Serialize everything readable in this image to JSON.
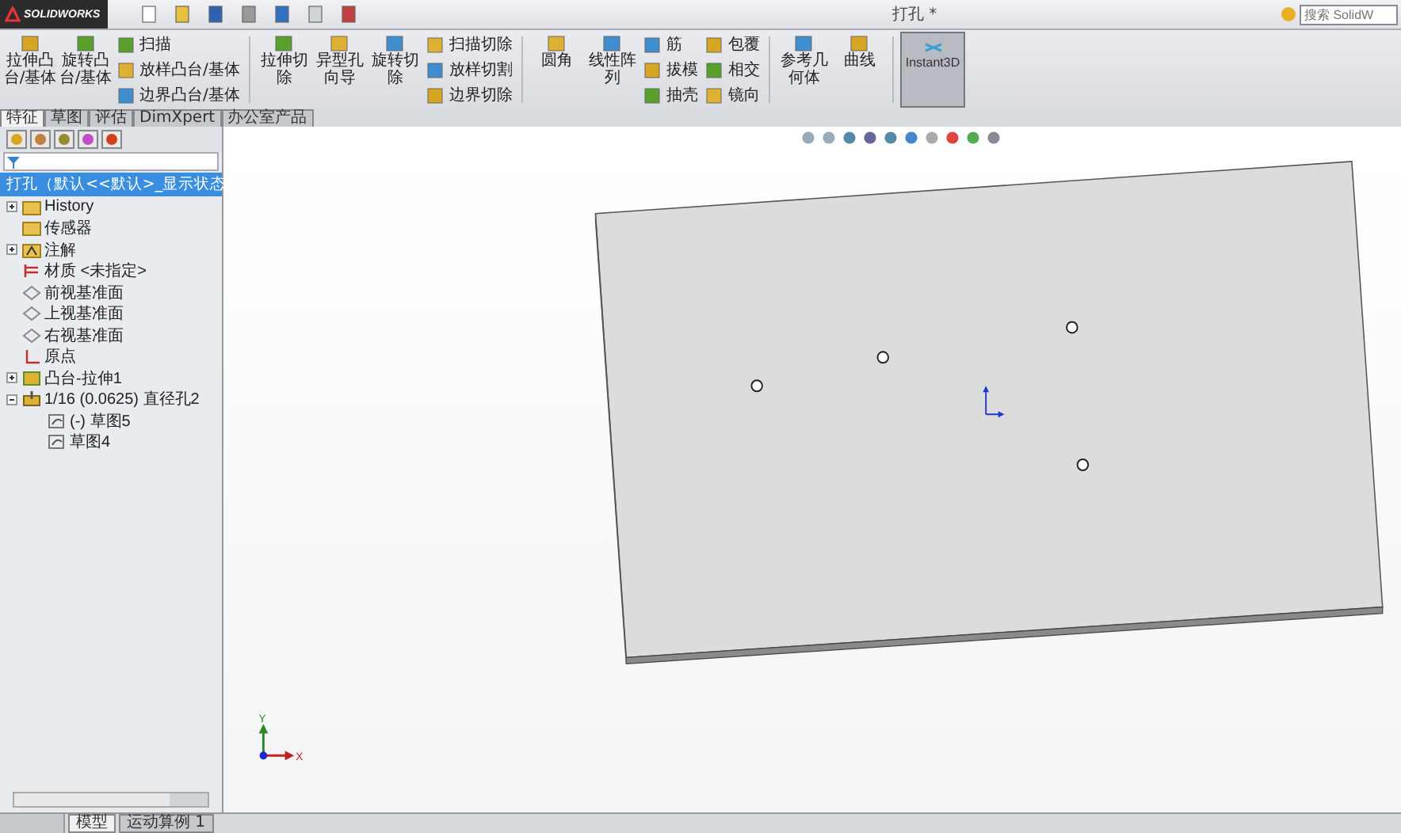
{
  "window": {
    "title": "打孔 *",
    "brand": "SOLIDWORKS",
    "search": {
      "placeholder": "搜索 SolidW"
    }
  },
  "ribbon": {
    "groups": [
      {
        "large": [
          "拉伸凸台/基体",
          "旋转凸台/基体"
        ],
        "small_columns": [
          [
            "扫描",
            "放样凸台/基体",
            "边界凸台/基体"
          ]
        ]
      },
      {
        "large": [
          "拉伸切除",
          "异型孔向导",
          "旋转切除"
        ],
        "small_columns": [
          [
            "扫描切除",
            "放样切割",
            "边界切除"
          ]
        ]
      },
      {
        "large": [
          "圆角",
          "线性阵列"
        ],
        "small_columns": [
          [
            "筋",
            "拔模",
            "抽壳"
          ],
          [
            "包覆",
            "相交",
            "镜向"
          ]
        ]
      },
      {
        "large": [
          "参考几何体",
          "曲线"
        ]
      }
    ],
    "toggle": {
      "label": "Instant3D",
      "on": true
    }
  },
  "tabs": [
    {
      "label": "特征",
      "selected": true
    },
    {
      "label": "草图",
      "selected": false
    },
    {
      "label": "评估",
      "selected": false
    },
    {
      "label": "DimXpert",
      "selected": false
    },
    {
      "label": "办公室产品",
      "selected": false
    }
  ],
  "tree": {
    "root": {
      "label": "打孔（默认<<默认>_显示状态",
      "selected": true
    },
    "items": [
      {
        "label": "History",
        "kind": "folder",
        "expanded": false
      },
      {
        "label": "传感器",
        "kind": "folder"
      },
      {
        "label": "注解",
        "kind": "annotation",
        "expanded": false
      },
      {
        "label": "材质 <未指定>",
        "kind": "material"
      },
      {
        "label": "前视基准面",
        "kind": "plane"
      },
      {
        "label": "上视基准面",
        "kind": "plane"
      },
      {
        "label": "右视基准面",
        "kind": "plane"
      },
      {
        "label": "原点",
        "kind": "origin"
      },
      {
        "label": "凸台-拉伸1",
        "kind": "feature",
        "expanded": false
      },
      {
        "label": "1/16 (0.0625) 直径孔2",
        "kind": "hole",
        "expanded": true,
        "children": [
          {
            "label": "(-) 草图5",
            "kind": "sketch"
          },
          {
            "label": "草图4",
            "kind": "sketch"
          }
        ]
      }
    ]
  },
  "viewport": {
    "axis_labels": [
      "Y",
      "X"
    ]
  },
  "bottom_tabs": [
    {
      "label": "模型",
      "selected": true
    },
    {
      "label": "运动算例 1",
      "selected": false
    }
  ]
}
